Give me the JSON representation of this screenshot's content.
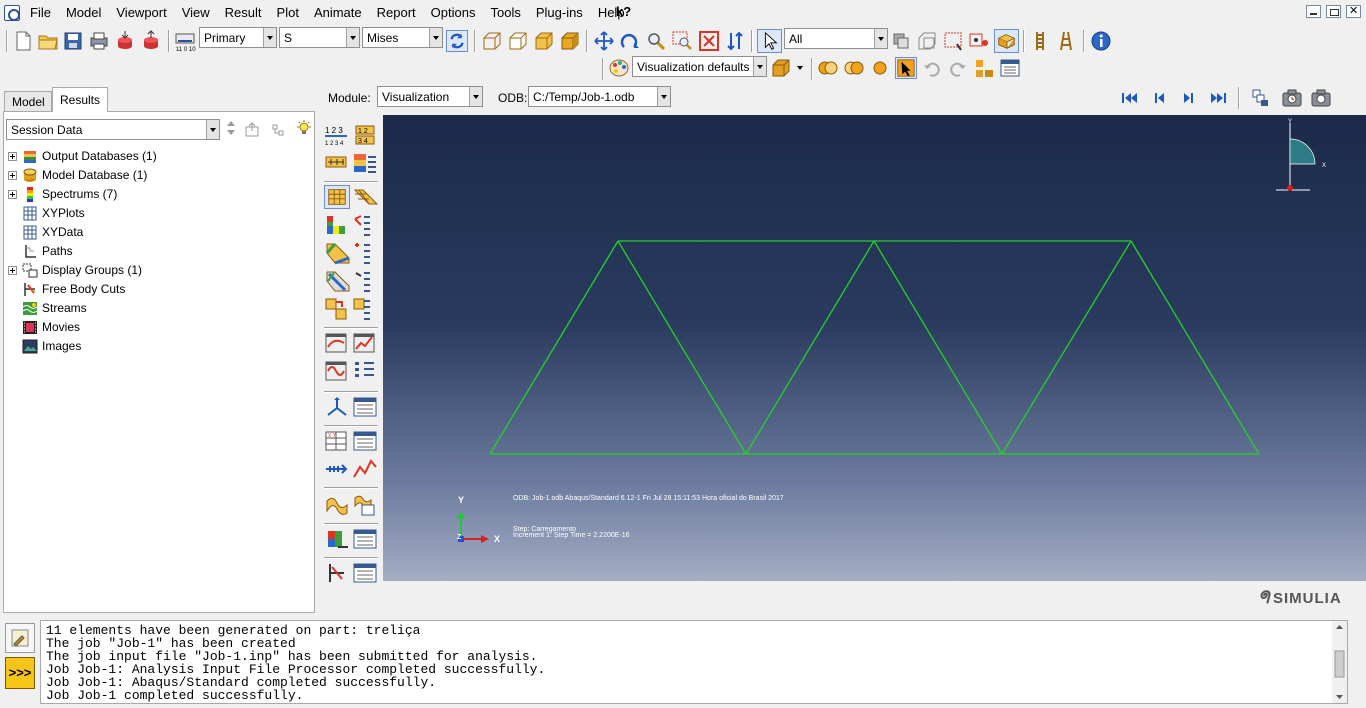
{
  "menu": {
    "items": [
      "File",
      "Model",
      "Viewport",
      "View",
      "Result",
      "Plot",
      "Animate",
      "Report",
      "Options",
      "Tools",
      "Plug-ins",
      "Help"
    ],
    "help_glyph": "k?"
  },
  "toolbar": {
    "step_combo": "Primary",
    "variable_combo": "S",
    "component_combo": "Mises",
    "selection_combo": "All",
    "render_style_combo": "Visualization defaults"
  },
  "context": {
    "module_label": "Module:",
    "module_value": "Visualization",
    "odb_label": "ODB:",
    "odb_value": "C:/Temp/Job-1.odb"
  },
  "left_panel": {
    "tabs": [
      {
        "label": "Model",
        "active": false
      },
      {
        "label": "Results",
        "active": true
      }
    ],
    "session_combo": "Session Data",
    "tree": [
      {
        "label": "Output Databases (1)",
        "expandable": true,
        "icon": "output-databases-icon"
      },
      {
        "label": "Model Database (1)",
        "expandable": true,
        "icon": "model-database-icon"
      },
      {
        "label": "Spectrums (7)",
        "expandable": true,
        "icon": "spectrum-icon"
      },
      {
        "label": "XYPlots",
        "expandable": false,
        "icon": "xyplot-icon"
      },
      {
        "label": "XYData",
        "expandable": false,
        "icon": "xydata-icon"
      },
      {
        "label": "Paths",
        "expandable": false,
        "icon": "path-icon"
      },
      {
        "label": "Display Groups (1)",
        "expandable": true,
        "icon": "display-groups-icon"
      },
      {
        "label": "Free Body Cuts",
        "expandable": false,
        "icon": "free-body-cut-icon"
      },
      {
        "label": "Streams",
        "expandable": false,
        "icon": "stream-icon"
      },
      {
        "label": "Movies",
        "expandable": false,
        "icon": "movie-icon"
      },
      {
        "label": "Images",
        "expandable": false,
        "icon": "image-icon"
      }
    ]
  },
  "viewport": {
    "info_line1": "ODB: Job-1.odb    Abaqus/Standard 6.12-1    Fri Jul 28 15:11:53 Hora oficial do Brasil 2017",
    "info_line2": "Step: Carregamento",
    "info_line3": "Increment     1: Step Time =    2.2200E-16",
    "triad_y": "Y",
    "triad_x": "X",
    "triad_z": "Z",
    "mini_triad_y": "Y",
    "mini_triad_x": "X",
    "colors": {
      "mesh": "#22d22a",
      "background_top": "#1b2a48",
      "background_bottom": "#a3adc4"
    }
  },
  "brand": "SIMULIA",
  "messages": [
    "11 elements have been generated on part: treliça",
    "The job \"Job-1\" has been created",
    "The job input file \"Job-1.inp\" has been submitted for analysis.",
    "Job Job-1: Analysis Input File Processor completed successfully.",
    "Job Job-1: Abaqus/Standard completed successfully.",
    "Job Job-1 completed successfully."
  ],
  "message_button": ">>>"
}
